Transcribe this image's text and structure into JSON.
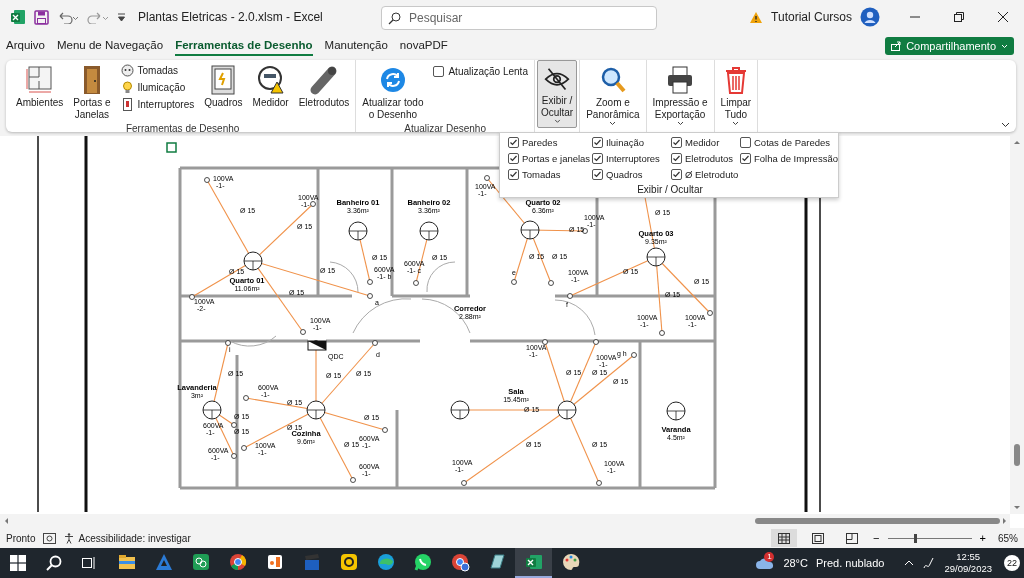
{
  "window": {
    "title": "Plantas Eletricas - 2.0.xlsm  -  Excel",
    "account": "Tutorial Cursos"
  },
  "search": {
    "placeholder": "Pesquisar"
  },
  "menu_tabs": [
    {
      "label": "Arquivo",
      "selected": false
    },
    {
      "label": "Menu de Navegação",
      "selected": false
    },
    {
      "label": "Ferramentas de Desenho",
      "selected": true
    },
    {
      "label": "Manutenção",
      "selected": false
    },
    {
      "label": "novaPDF",
      "selected": false
    }
  ],
  "share_button": "Compartilhamento",
  "ribbon_groups": [
    {
      "label": "Ferramentas de Desenho",
      "buttons": [
        {
          "kind": "large",
          "label": "Ambientes",
          "selected": false,
          "dropdown": false
        },
        {
          "kind": "large",
          "label": "Portas e\nJanelas",
          "selected": false,
          "dropdown": false
        },
        {
          "kind": "stack",
          "items": [
            "Tomadas",
            "Ilumicação",
            "Interruptores"
          ]
        },
        {
          "kind": "large",
          "label": "Quadros",
          "selected": false,
          "dropdown": false
        },
        {
          "kind": "large",
          "label": "Medidor",
          "selected": false,
          "dropdown": false
        },
        {
          "kind": "large",
          "label": "Eletrodutos",
          "selected": false,
          "dropdown": false
        }
      ]
    },
    {
      "label": "Atualizar Desenho",
      "buttons": [
        {
          "kind": "large",
          "label": "Atualizar todo\no Desenho",
          "selected": false,
          "dropdown": false
        },
        {
          "kind": "checkbox",
          "label": "Atualização Lenta",
          "checked": false
        }
      ]
    },
    {
      "buttons": [
        {
          "kind": "large",
          "label": "Exibir /\nOcultar",
          "selected": true,
          "dropdown": true
        }
      ]
    },
    {
      "buttons": [
        {
          "kind": "large",
          "label": "Zoom e\nPanorâmica",
          "selected": false,
          "dropdown": true
        }
      ]
    },
    {
      "buttons": [
        {
          "kind": "large",
          "label": "Impressão e\nExportação",
          "selected": false,
          "dropdown": true
        }
      ]
    },
    {
      "buttons": [
        {
          "kind": "large",
          "label": "Limpar\nTudo",
          "selected": false,
          "dropdown": true
        }
      ]
    }
  ],
  "display_panel": {
    "label": "Exibir / Ocultar",
    "options": [
      {
        "label": "Paredes",
        "checked": true
      },
      {
        "label": "Iluinação",
        "checked": true
      },
      {
        "label": "Medidor",
        "checked": true
      },
      {
        "label": "Cotas de Paredes",
        "checked": false
      },
      {
        "label": "Portas e janelas",
        "checked": true
      },
      {
        "label": "Interruptores",
        "checked": true
      },
      {
        "label": "Eletrodutos",
        "checked": true
      },
      {
        "label": "Folha de Impressão",
        "checked": true
      },
      {
        "label": "Tomadas",
        "checked": true
      },
      {
        "label": "Quadros",
        "checked": true
      },
      {
        "label": "Ø Eletroduto",
        "checked": true
      }
    ]
  },
  "plan": {
    "rooms": [
      {
        "name": "Quarto 01",
        "area": "11.06m²"
      },
      {
        "name": "Banheiro 01",
        "area": "3.36m²"
      },
      {
        "name": "Banheiro 02",
        "area": "3.36m²"
      },
      {
        "name": "Quarto 02",
        "area": "6.36m²"
      },
      {
        "name": "Quarto 03",
        "area": "9.35m²"
      },
      {
        "name": "Corredor",
        "area": "2.88m²"
      },
      {
        "name": "Lavanderia",
        "area": "3m²"
      },
      {
        "name": "Cozinha",
        "area": "9.6m²"
      },
      {
        "name": "Sala",
        "area": "15.45m²"
      },
      {
        "name": "Varanda",
        "area": "4.5m²"
      }
    ],
    "loads": [
      {
        "power": "100VA",
        "circuit": "-1-"
      },
      {
        "power": "100VA",
        "circuit": "-1-"
      },
      {
        "power": "100VA",
        "circuit": "-2-"
      },
      {
        "power": "100VA",
        "circuit": "-1-"
      },
      {
        "power": "600VA",
        "circuit": "-1-  b"
      },
      {
        "power": "600VA",
        "circuit": "-1-  c"
      },
      {
        "power": "100VA",
        "circuit": "-1-"
      },
      {
        "power": "100VA",
        "circuit": "-1-"
      },
      {
        "power": "100VA",
        "circuit": "-1-"
      },
      {
        "power": "100VA",
        "circuit": "-1-"
      },
      {
        "power": "100VA",
        "circuit": "-1-"
      },
      {
        "power": "600VA",
        "circuit": "-1-"
      },
      {
        "power": "600VA",
        "circuit": "-1-"
      },
      {
        "power": "600VA",
        "circuit": "-1-"
      },
      {
        "power": "100VA",
        "circuit": "-1-"
      },
      {
        "power": "600VA",
        "circuit": "-1-"
      },
      {
        "power": "600VA",
        "circuit": "-1-"
      },
      {
        "power": "100VA",
        "circuit": "-1-"
      },
      {
        "power": "100VA",
        "circuit": "-1-"
      },
      {
        "power": "100VA",
        "circuit": "-1-"
      },
      {
        "power": "100VA",
        "circuit": "-1-"
      }
    ],
    "switch_labels": [
      "a",
      "f",
      "d",
      "i",
      "e",
      "g  h"
    ],
    "panel_label": "QDC",
    "conduit_labels": [
      "Ø 15",
      "Ø 15",
      "Ø 15",
      "Ø 15",
      "Ø 15",
      "Ø 15",
      "Ø 15",
      "Ø 15",
      "Ø 15",
      "Ø 15",
      "Ø 15",
      "Ø 15",
      "Ø 15",
      "Ø 15",
      "Ø 15",
      "Ø 15",
      "Ø 15",
      "Ø 15",
      "Ø 15",
      "Ø 15",
      "Ø 15",
      "Ø 15",
      "Ø 15",
      "Ø 15",
      "Ø 15",
      "Ø 15",
      "Ø 15",
      "Ø 15",
      "Ø 15"
    ]
  },
  "status_bar": {
    "mode": "Pronto",
    "accessibility": "Acessibilidade: investigar",
    "views": [
      {
        "selected": true
      },
      {
        "selected": false
      },
      {
        "selected": false
      }
    ],
    "zoom_out": "−",
    "zoom_in": "+",
    "zoom": {
      "level": 0.33,
      "reading": "65%"
    }
  },
  "taskbar": {
    "apps": [
      {
        "selected": false
      },
      {
        "selected": false
      },
      {
        "selected": false
      },
      {
        "selected": false
      },
      {
        "selected": false
      },
      {
        "selected": false
      },
      {
        "selected": false
      },
      {
        "selected": false
      },
      {
        "selected": false
      },
      {
        "selected": false
      },
      {
        "selected": false
      },
      {
        "selected": true
      },
      {
        "selected": false
      }
    ],
    "weather": {
      "badge": "1",
      "temperature": "28°C",
      "condition": "Pred. nublado"
    },
    "clock": {
      "time": "12:55",
      "date": "29/09/2023"
    },
    "notifications": "22"
  }
}
